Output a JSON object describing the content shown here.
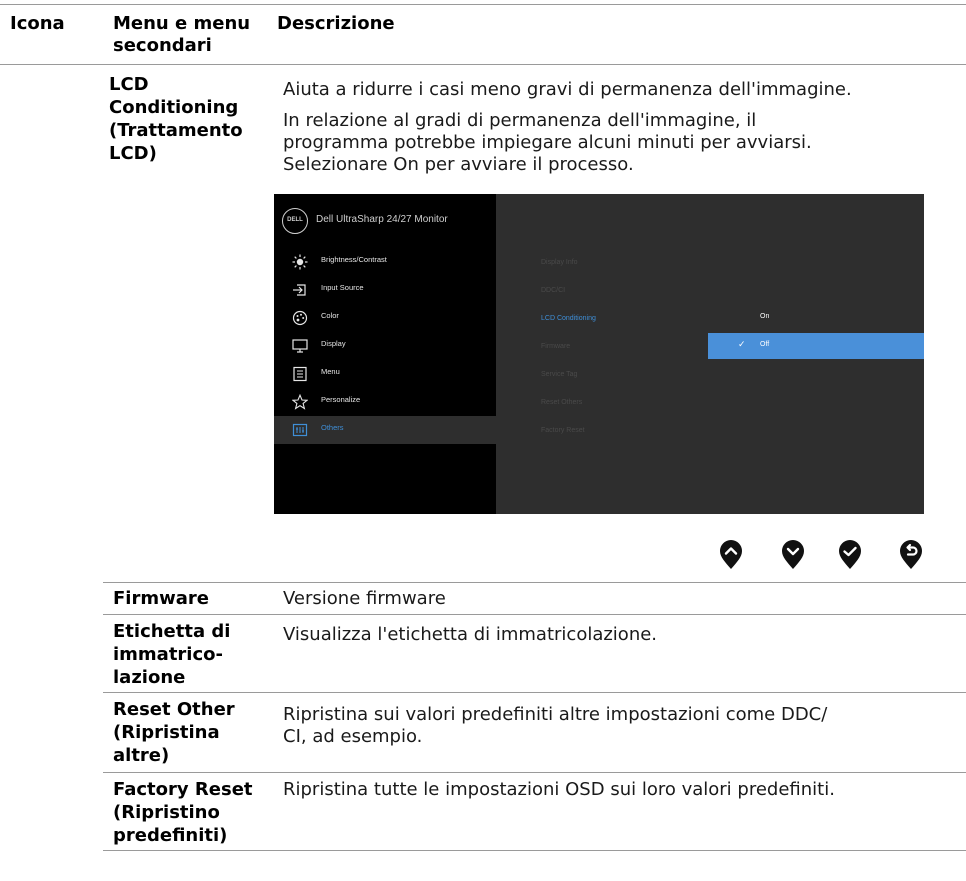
{
  "header": {
    "col_icon": "Icona",
    "col_menu_line1": "Menu e menu",
    "col_menu_line2": "secondari",
    "col_desc": "Descrizione"
  },
  "lcd": {
    "label_lines": [
      "LCD",
      "Conditioning",
      "(Trattamento",
      "LCD)"
    ],
    "desc1": "Aiuta a ridurre i casi meno gravi di permanenza dell'immagine.",
    "desc2_lines": [
      "In relazione al gradi di permanenza dell'immagine, il",
      "programma potrebbe impiegare alcuni minuti per avviarsi.",
      "Selezionare On per avviare il processo."
    ]
  },
  "osd": {
    "logo": "DELL",
    "title": "Dell UltraSharp 24/27 Monitor",
    "menu": [
      {
        "label": "Brightness/Contrast",
        "icon": "brightness-icon"
      },
      {
        "label": "Input Source",
        "icon": "input-source-icon"
      },
      {
        "label": "Color",
        "icon": "color-palette-icon"
      },
      {
        "label": "Display",
        "icon": "display-icon"
      },
      {
        "label": "Menu",
        "icon": "menu-icon"
      },
      {
        "label": "Personalize",
        "icon": "star-icon"
      },
      {
        "label": "Others",
        "icon": "others-icon"
      }
    ],
    "selected_menu": "Others",
    "submenu": [
      "Display Info",
      "DDC/CI",
      "LCD Conditioning",
      "Firmware",
      "Service Tag",
      "Reset Others",
      "Factory Reset"
    ],
    "active_submenu": "LCD Conditioning",
    "options": [
      "On",
      "Off"
    ],
    "checked_option": "Off",
    "accent_color": "#4a90d9"
  },
  "nav_buttons": [
    "up-arrow-icon",
    "down-arrow-icon",
    "check-icon",
    "back-icon"
  ],
  "rows": [
    {
      "label_lines": [
        "Firmware"
      ],
      "desc_lines": [
        "Versione firmware"
      ]
    },
    {
      "label_lines": [
        "Etichetta di",
        "immatrico-",
        "lazione"
      ],
      "desc_lines": [
        "Visualizza l'etichetta di immatricolazione."
      ]
    },
    {
      "label_lines": [
        "Reset Other",
        "(Ripristina",
        "altre)"
      ],
      "desc_lines": [
        "Ripristina sui valori predefiniti altre impostazioni come DDC/",
        "CI, ad esempio."
      ]
    },
    {
      "label_lines": [
        "Factory Reset",
        "(Ripristino",
        "predefiniti)"
      ],
      "desc_lines": [
        "Ripristina tutte le impostazioni OSD sui loro valori predefiniti."
      ]
    }
  ]
}
